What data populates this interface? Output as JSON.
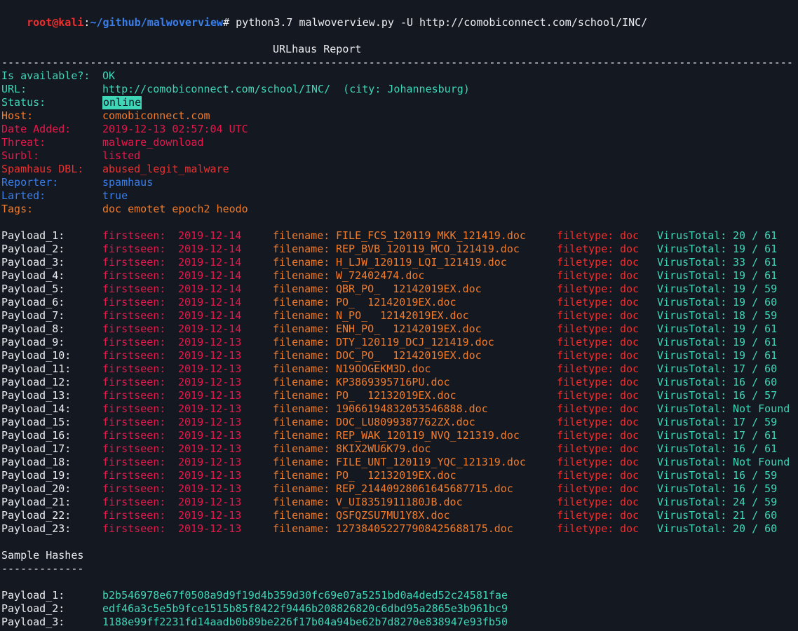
{
  "prompt": {
    "user_host": "root@kali",
    "separator": ":",
    "path": "~/github/malwoverview",
    "symbol": "#",
    "command": " python3.7 malwoverview.py -U http://comobiconnect.com/school/INC/"
  },
  "report": {
    "title": "URLhaus Report",
    "dashes": "-----------------------------------------------------------------------------------------------------------------------------",
    "fields": [
      {
        "label": "Is available?:",
        "value": "OK",
        "color": "teal"
      },
      {
        "label": "URL:",
        "value": "http://comobiconnect.com/school/INC/  (city: Johannesburg)",
        "color": "teal"
      },
      {
        "label": "Status:",
        "value": "online",
        "color": "teal",
        "badge": true
      },
      {
        "label": "Host:",
        "value": "comobiconnect.com",
        "color": "orange"
      },
      {
        "label": "Date Added:",
        "value": "2019-12-13 02:57:04 UTC",
        "color": "red"
      },
      {
        "label": "Threat:",
        "value": "malware_download",
        "color": "red"
      },
      {
        "label": "Surbl:",
        "value": "listed",
        "color": "red"
      },
      {
        "label": "Spamhaus DBL:",
        "value": "abused_legit_malware",
        "color": "crimson"
      },
      {
        "label": "Reporter:",
        "value": "spamhaus",
        "color": "blue"
      },
      {
        "label": "Larted:",
        "value": "true",
        "color": "blue"
      },
      {
        "label": "Tags:",
        "value": "doc emotet epoch2 heodo",
        "color": "orange"
      }
    ]
  },
  "payload_labels": {
    "firstseen": "firstseen:",
    "filename": "filename:",
    "filetype": "filetype:",
    "virustotal": "VirusTotal:"
  },
  "payloads": [
    {
      "name": "Payload_1:",
      "firstseen": "2019-12-14",
      "filename": "FILE_FCS_120119_MKK_121419.doc",
      "filetype": "doc",
      "virustotal": "20 / 61"
    },
    {
      "name": "Payload_2:",
      "firstseen": "2019-12-14",
      "filename": "REP_BVB_120119_MCO_121419.doc",
      "filetype": "doc",
      "virustotal": "19 / 61"
    },
    {
      "name": "Payload_3:",
      "firstseen": "2019-12-14",
      "filename": "H_LJW_120119_LQI_121419.doc",
      "filetype": "doc",
      "virustotal": "33 / 61"
    },
    {
      "name": "Payload_4:",
      "firstseen": "2019-12-14",
      "filename": "W_72402474.doc",
      "filetype": "doc",
      "virustotal": "19 / 61"
    },
    {
      "name": "Payload_5:",
      "firstseen": "2019-12-14",
      "filename": "QBR_PO_  12142019EX.doc",
      "filetype": "doc",
      "virustotal": "19 / 59"
    },
    {
      "name": "Payload_6:",
      "firstseen": "2019-12-14",
      "filename": "PO_  12142019EX.doc",
      "filetype": "doc",
      "virustotal": "19 / 60"
    },
    {
      "name": "Payload_7:",
      "firstseen": "2019-12-14",
      "filename": "N_PO_  12142019EX.doc",
      "filetype": "doc",
      "virustotal": "18 / 59"
    },
    {
      "name": "Payload_8:",
      "firstseen": "2019-12-14",
      "filename": "ENH_PO_  12142019EX.doc",
      "filetype": "doc",
      "virustotal": "19 / 61"
    },
    {
      "name": "Payload_9:",
      "firstseen": "2019-12-13",
      "filename": "DTY_120119_DCJ_121419.doc",
      "filetype": "doc",
      "virustotal": "19 / 61"
    },
    {
      "name": "Payload_10:",
      "firstseen": "2019-12-13",
      "filename": "DOC_PO_  12142019EX.doc",
      "filetype": "doc",
      "virustotal": "19 / 61"
    },
    {
      "name": "Payload_11:",
      "firstseen": "2019-12-13",
      "filename": "N19OOGEKM3D.doc",
      "filetype": "doc",
      "virustotal": "17 / 60"
    },
    {
      "name": "Payload_12:",
      "firstseen": "2019-12-13",
      "filename": "KP3869395716PU.doc",
      "filetype": "doc",
      "virustotal": "16 / 60"
    },
    {
      "name": "Payload_13:",
      "firstseen": "2019-12-13",
      "filename": "PO_  12132019EX.doc",
      "filetype": "doc",
      "virustotal": "16 / 57"
    },
    {
      "name": "Payload_14:",
      "firstseen": "2019-12-13",
      "filename": "19066194832053546888.doc",
      "filetype": "doc",
      "virustotal": "Not Found"
    },
    {
      "name": "Payload_15:",
      "firstseen": "2019-12-13",
      "filename": "DOC_LU8099387762ZX.doc",
      "filetype": "doc",
      "virustotal": "17 / 59"
    },
    {
      "name": "Payload_16:",
      "firstseen": "2019-12-13",
      "filename": "REP_WAK_120119_NVQ_121319.doc",
      "filetype": "doc",
      "virustotal": "17 / 61"
    },
    {
      "name": "Payload_17:",
      "firstseen": "2019-12-13",
      "filename": "8KIX2WU6K79.doc",
      "filetype": "doc",
      "virustotal": "16 / 61"
    },
    {
      "name": "Payload_18:",
      "firstseen": "2019-12-13",
      "filename": "FILE_UNT_120119_YQC_121319.doc",
      "filetype": "doc",
      "virustotal": "Not Found"
    },
    {
      "name": "Payload_19:",
      "firstseen": "2019-12-13",
      "filename": "PO_  12132019EX.doc",
      "filetype": "doc",
      "virustotal": "16 / 59"
    },
    {
      "name": "Payload_20:",
      "firstseen": "2019-12-13",
      "filename": "REP_21440928061645687715.doc",
      "filetype": "doc",
      "virustotal": "16 / 59"
    },
    {
      "name": "Payload_21:",
      "firstseen": "2019-12-13",
      "filename": "V_UI8351911180JB.doc",
      "filetype": "doc",
      "virustotal": "24 / 59"
    },
    {
      "name": "Payload_22:",
      "firstseen": "2019-12-13",
      "filename": "QSFQZSU7MU1Y8X.doc",
      "filetype": "doc",
      "virustotal": "21 / 60"
    },
    {
      "name": "Payload_23:",
      "firstseen": "2019-12-13",
      "filename": "127384052277908425688175.doc",
      "filetype": "doc",
      "virustotal": "20 / 60"
    }
  ],
  "hashes": {
    "title": "Sample Hashes",
    "underline": "-------------",
    "items": [
      {
        "name": "Payload_1:",
        "hash": "b2b546978e67f0508a9d9f19d4b359d30fc69e07a5251bd0a4ded52c24581fae"
      },
      {
        "name": "Payload_2:",
        "hash": "edf46a3c5e5b9fce1515b85f8422f9446b208826820c6dbd95a2865e3b961bc9"
      },
      {
        "name": "Payload_3:",
        "hash": "1188e99ff2231fd14aadb0b89be226f17b04a94be62b7d8270e838947e93fb50"
      }
    ]
  },
  "colors": {
    "background": "#141821",
    "white": "#ecedf0",
    "red": "#e8174b",
    "orange": "#f27b2a",
    "teal": "#3fd6b8",
    "blue": "#3a7ee8",
    "crimson": "#ef2e2e"
  }
}
